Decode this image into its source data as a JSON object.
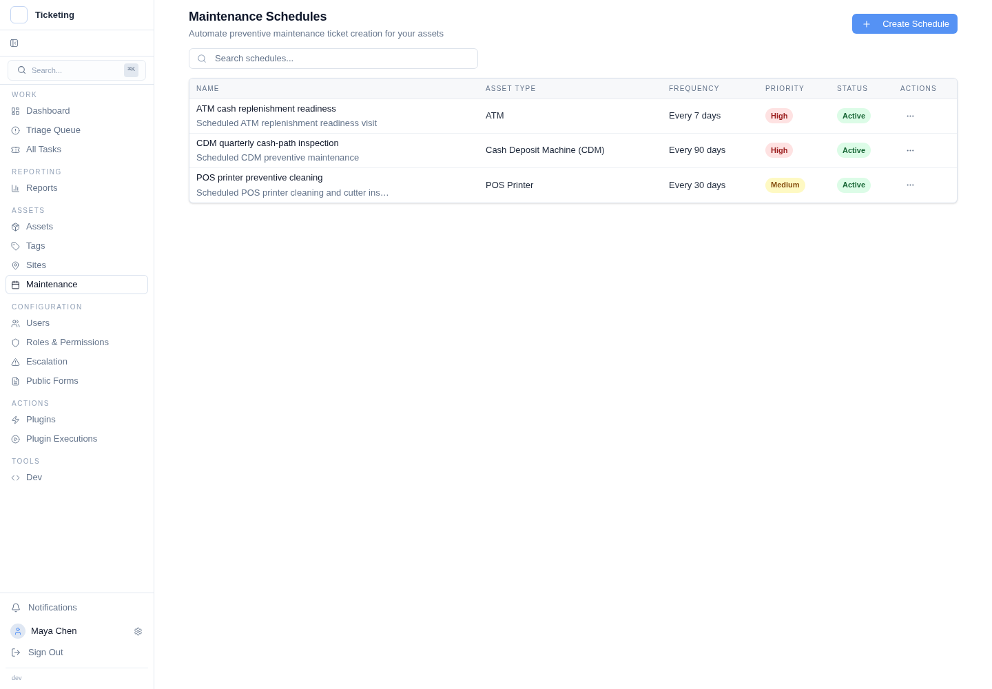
{
  "sidebar": {
    "app_name": "Ticketing",
    "search": {
      "placeholder": "Search...",
      "shortcut": "⌘K"
    },
    "sections": [
      {
        "heading": "WORK",
        "items": [
          {
            "label": "Dashboard",
            "selected": false
          },
          {
            "label": "Triage Queue",
            "selected": false
          },
          {
            "label": "All Tasks",
            "selected": false
          }
        ]
      },
      {
        "heading": "REPORTING",
        "items": [
          {
            "label": "Reports",
            "selected": false
          }
        ]
      },
      {
        "heading": "ASSETS",
        "items": [
          {
            "label": "Assets",
            "selected": false
          },
          {
            "label": "Tags",
            "selected": false
          },
          {
            "label": "Sites",
            "selected": false
          },
          {
            "label": "Maintenance",
            "selected": true
          }
        ]
      },
      {
        "heading": "CONFIGURATION",
        "items": [
          {
            "label": "Users",
            "selected": false
          },
          {
            "label": "Roles & Permissions",
            "selected": false
          },
          {
            "label": "Escalation",
            "selected": false
          },
          {
            "label": "Public Forms",
            "selected": false
          }
        ]
      },
      {
        "heading": "ACTIONS",
        "items": [
          {
            "label": "Plugins",
            "selected": false
          },
          {
            "label": "Plugin Executions",
            "selected": false
          }
        ]
      },
      {
        "heading": "TOOLS",
        "items": [
          {
            "label": "Dev",
            "selected": false
          }
        ]
      }
    ],
    "footer": {
      "notifications": "Notifications",
      "user_name": "Maya Chen",
      "sign_out": "Sign Out",
      "environment": "dev"
    }
  },
  "page": {
    "title": "Maintenance Schedules",
    "subtitle": "Automate preventive maintenance ticket creation for your assets",
    "create_button": "Create Schedule",
    "search": {
      "placeholder": "Search schedules..."
    }
  },
  "table": {
    "columns": [
      "NAME",
      "ASSET TYPE",
      "FREQUENCY",
      "PRIORITY",
      "STATUS",
      "ACTIONS"
    ],
    "rows": [
      {
        "name": "ATM cash replenishment readiness",
        "description": "Scheduled ATM replenishment readiness visit",
        "asset_type": "ATM",
        "frequency": "Every 7 days",
        "priority": {
          "text": "High",
          "kind": "high"
        },
        "status": {
          "text": "Active",
          "kind": "active"
        }
      },
      {
        "name": "CDM quarterly cash-path inspection",
        "description": "Scheduled CDM preventive maintenance",
        "asset_type": "Cash Deposit Machine (CDM)",
        "frequency": "Every 90 days",
        "priority": {
          "text": "High",
          "kind": "high"
        },
        "status": {
          "text": "Active",
          "kind": "active"
        }
      },
      {
        "name": "POS printer preventive cleaning",
        "description": "Scheduled POS printer cleaning and cutter ins…",
        "asset_type": "POS Printer",
        "frequency": "Every 30 days",
        "priority": {
          "text": "Medium",
          "kind": "medium"
        },
        "status": {
          "text": "Active",
          "kind": "active"
        }
      }
    ]
  }
}
